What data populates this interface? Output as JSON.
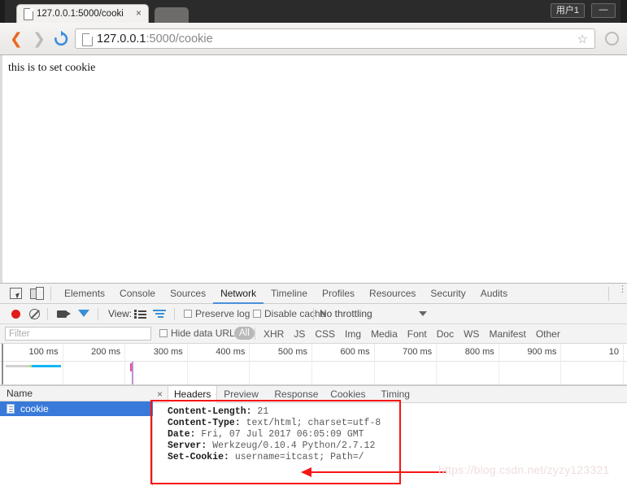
{
  "window": {
    "user_label": "用户1",
    "minimize_label": "—"
  },
  "tab": {
    "title": "127.0.0.1:5000/cooki",
    "close_label": "×",
    "favicon": "page-icon"
  },
  "navbar": {
    "back_label": "❮",
    "forward_label": "❯",
    "reload_label": "reload-icon",
    "url_host": "127.0.0.1",
    "url_rest": ":5000/cookie",
    "star_label": "☆",
    "menu_label": "menu-circle"
  },
  "page": {
    "body_text": "this is to set cookie"
  },
  "devtools": {
    "inspect_icon": "inspect-element-icon",
    "device_icon": "device-toolbar-icon",
    "tabs": [
      {
        "label": "Elements",
        "active": false
      },
      {
        "label": "Console",
        "active": false
      },
      {
        "label": "Sources",
        "active": false
      },
      {
        "label": "Network",
        "active": true
      },
      {
        "label": "Timeline",
        "active": false
      },
      {
        "label": "Profiles",
        "active": false
      },
      {
        "label": "Resources",
        "active": false
      },
      {
        "label": "Security",
        "active": false
      },
      {
        "label": "Audits",
        "active": false
      }
    ],
    "more_label": "⋮",
    "network_toolbar": {
      "record_icon": "record-button",
      "clear_icon": "clear-button",
      "camera_icon": "capture-screenshots-icon",
      "filter_icon": "filter-icon",
      "view_label": "View:",
      "view_list_icon": "list-view-icon",
      "view_waterfall_icon": "waterfall-view-icon",
      "preserve_log_label": "Preserve log",
      "preserve_log_checked": false,
      "disable_cache_label": "Disable cache",
      "disable_cache_checked": false,
      "throttling_value": "No throttling"
    },
    "filter_bar": {
      "filter_placeholder": "Filter",
      "filter_value": "",
      "hide_data_urls_label": "Hide data URLs",
      "hide_data_urls_checked": false,
      "all_pill": "All",
      "types": [
        "XHR",
        "JS",
        "CSS",
        "Img",
        "Media",
        "Font",
        "Doc",
        "WS",
        "Manifest",
        "Other"
      ]
    },
    "overview": {
      "ticks": [
        "100 ms",
        "200 ms",
        "300 ms",
        "400 ms",
        "500 ms",
        "600 ms",
        "700 ms",
        "800 ms",
        "900 ms",
        "10"
      ]
    },
    "requests": {
      "column_header": "Name",
      "rows": [
        {
          "name": "cookie",
          "selected": true
        }
      ]
    },
    "detail": {
      "close_label": "×",
      "tabs": [
        {
          "label": "Headers",
          "active": true
        },
        {
          "label": "Preview",
          "active": false
        },
        {
          "label": "Response",
          "active": false
        },
        {
          "label": "Cookies",
          "active": false
        },
        {
          "label": "Timing",
          "active": false
        }
      ],
      "headers": [
        {
          "name": "Content-Length:",
          "value": "21"
        },
        {
          "name": "Content-Type:",
          "value": "text/html; charset=utf-8"
        },
        {
          "name": "Date:",
          "value": "Fri, 07 Jul 2017 06:05:09 GMT"
        },
        {
          "name": "Server:",
          "value": "Werkzeug/0.10.4 Python/2.7.12"
        },
        {
          "name": "Set-Cookie:",
          "value": "username=itcast; Path=/"
        }
      ]
    }
  },
  "annotations": {
    "highlight_color": "#f71414",
    "watermark": "https://blog.csdn.net/zyzy123321"
  }
}
